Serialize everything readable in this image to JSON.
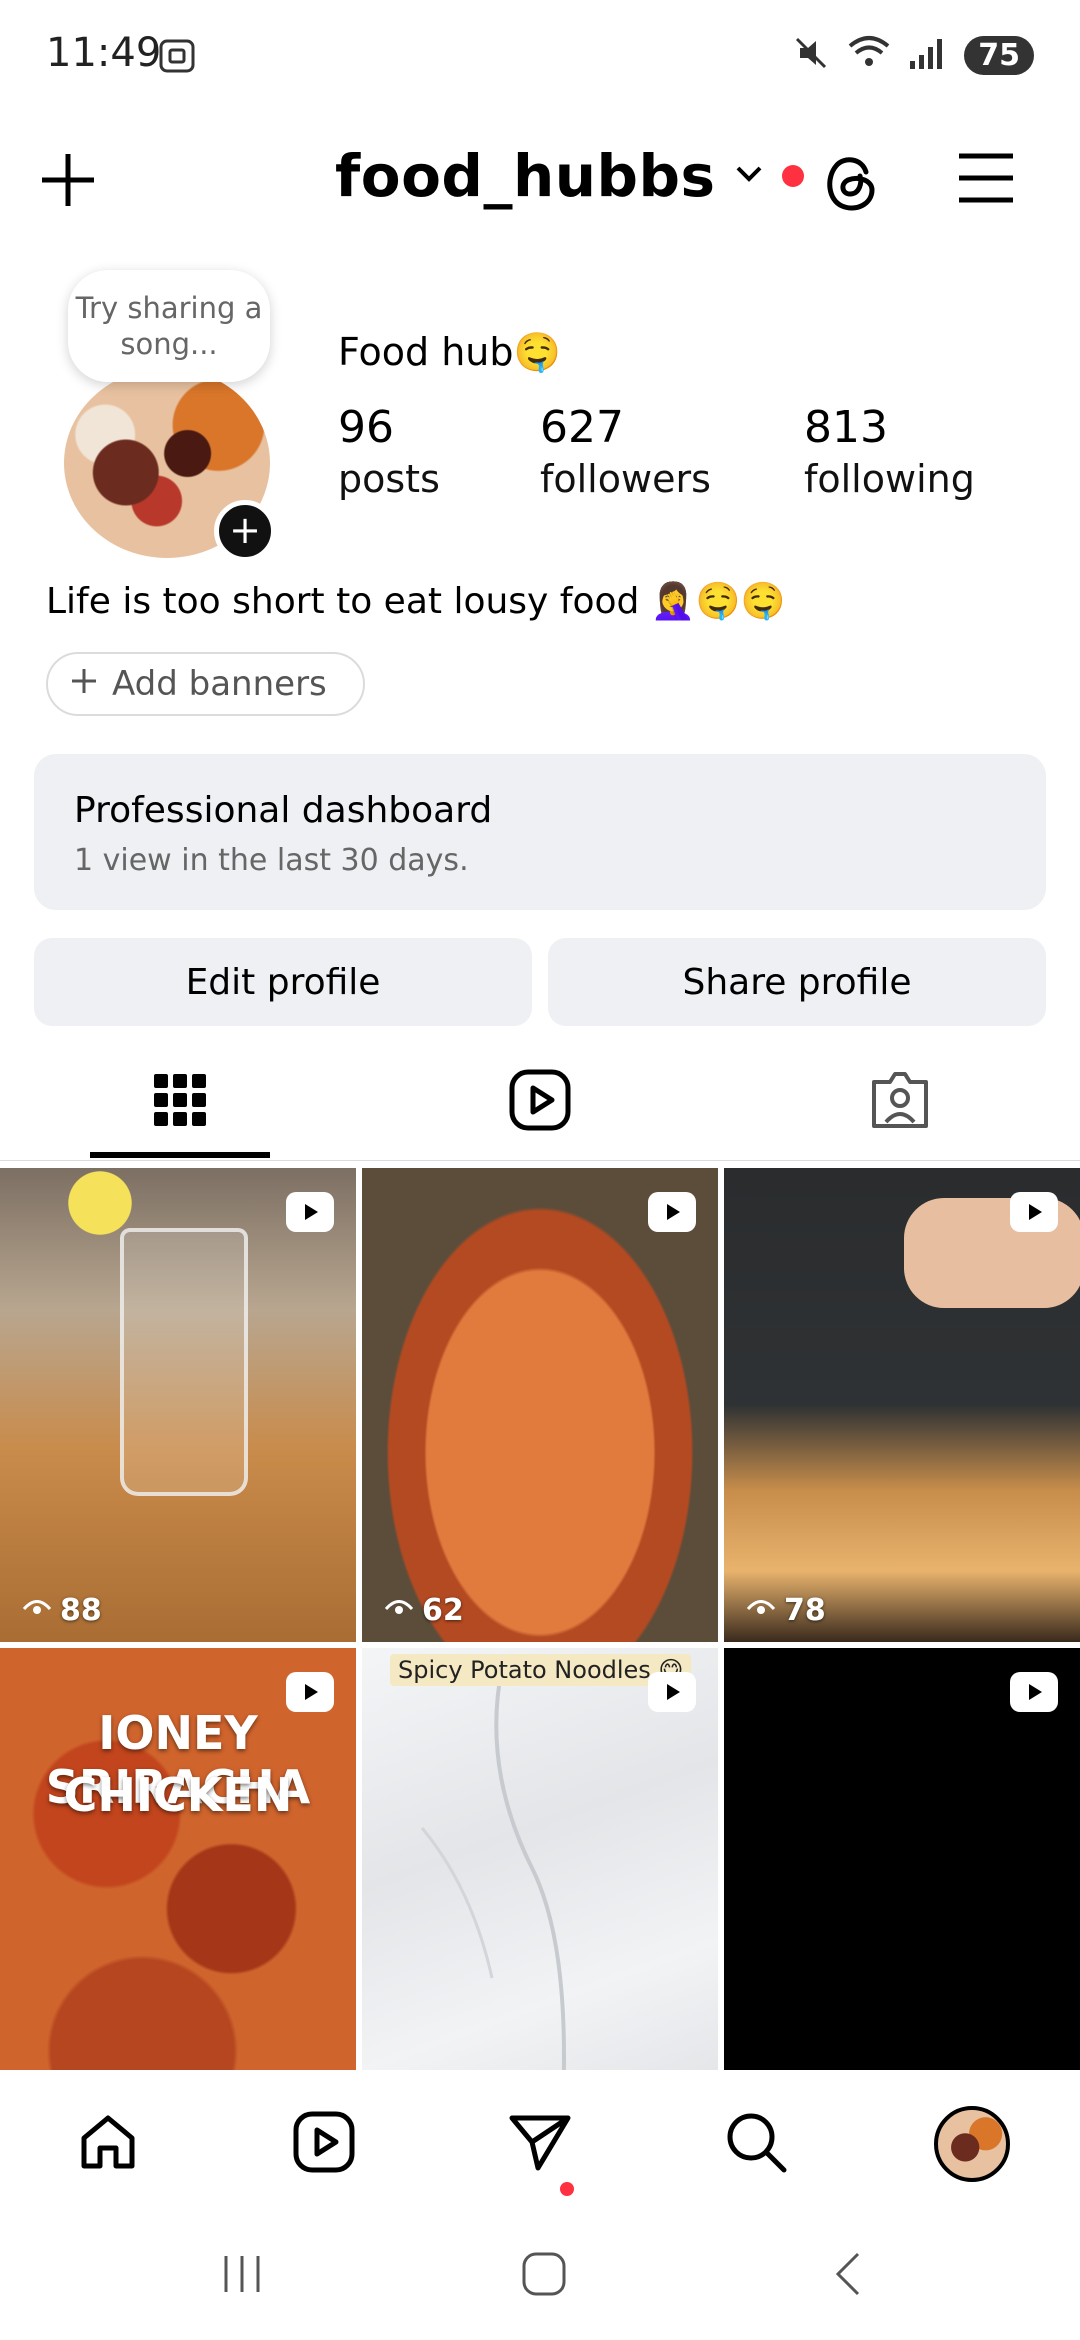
{
  "status_bar": {
    "time": "11:49",
    "battery": "75"
  },
  "header": {
    "username": "food_hubbs"
  },
  "profile": {
    "song_prompt": "Try sharing a song...",
    "display_name": "Food hub🤤",
    "stats": [
      {
        "value": "96",
        "label": "posts"
      },
      {
        "value": "627",
        "label": "followers"
      },
      {
        "value": "813",
        "label": "following"
      }
    ],
    "bio": "Life is too short to eat lousy food 🤦‍♀️🤤🤤",
    "add_banners": "Add banners"
  },
  "dashboard": {
    "title": "Professional dashboard",
    "subtitle": "1 view in the last 30 days."
  },
  "buttons": {
    "edit": "Edit profile",
    "share": "Share profile"
  },
  "grid": {
    "tiles": [
      {
        "views": "88"
      },
      {
        "views": "62"
      },
      {
        "views": "78"
      },
      {
        "overlay_line1": "IONEY SRIRACHA",
        "overlay_line2": "CHICKEN"
      },
      {
        "caption": "Spicy Potato Noodles 😋"
      },
      {}
    ]
  },
  "colors": {
    "accent_red": "#ff3040",
    "surface_gray": "#eff0f3"
  }
}
